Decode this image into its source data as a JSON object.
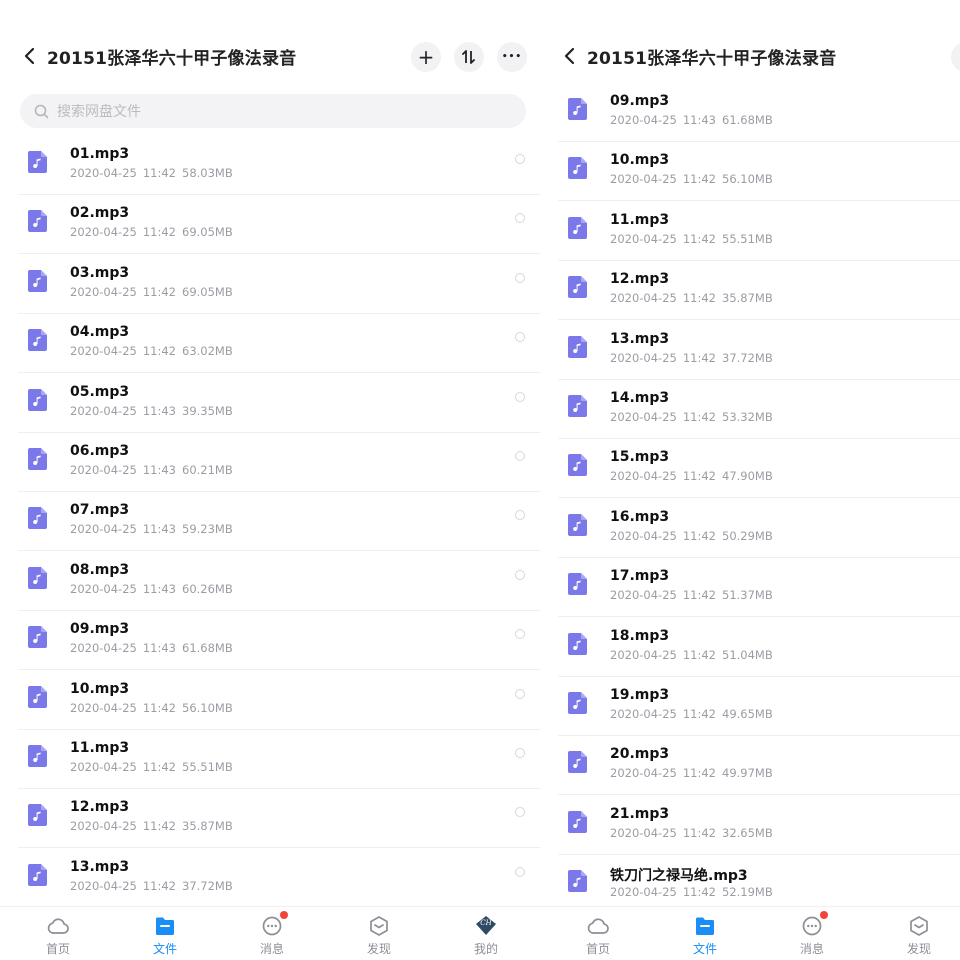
{
  "header": {
    "title": "20151张泽华六十甲子像法录音"
  },
  "toolbar": {
    "add_label": "+",
    "sort_label": "⇅",
    "more_label": "•••"
  },
  "search": {
    "placeholder": "搜索网盘文件"
  },
  "left_files": [
    {
      "name": "01.mp3",
      "date": "2020-04-25",
      "time": "11:42",
      "size": "58.03MB"
    },
    {
      "name": "02.mp3",
      "date": "2020-04-25",
      "time": "11:42",
      "size": "69.05MB"
    },
    {
      "name": "03.mp3",
      "date": "2020-04-25",
      "time": "11:42",
      "size": "69.05MB"
    },
    {
      "name": "04.mp3",
      "date": "2020-04-25",
      "time": "11:42",
      "size": "63.02MB"
    },
    {
      "name": "05.mp3",
      "date": "2020-04-25",
      "time": "11:43",
      "size": "39.35MB"
    },
    {
      "name": "06.mp3",
      "date": "2020-04-25",
      "time": "11:43",
      "size": "60.21MB"
    },
    {
      "name": "07.mp3",
      "date": "2020-04-25",
      "time": "11:43",
      "size": "59.23MB"
    },
    {
      "name": "08.mp3",
      "date": "2020-04-25",
      "time": "11:43",
      "size": "60.26MB"
    },
    {
      "name": "09.mp3",
      "date": "2020-04-25",
      "time": "11:43",
      "size": "61.68MB"
    },
    {
      "name": "10.mp3",
      "date": "2020-04-25",
      "time": "11:42",
      "size": "56.10MB"
    },
    {
      "name": "11.mp3",
      "date": "2020-04-25",
      "time": "11:42",
      "size": "55.51MB"
    },
    {
      "name": "12.mp3",
      "date": "2020-04-25",
      "time": "11:42",
      "size": "35.87MB"
    },
    {
      "name": "13.mp3",
      "date": "2020-04-25",
      "time": "11:42",
      "size": "37.72MB"
    }
  ],
  "right_files": [
    {
      "name": "09.mp3",
      "date": "2020-04-25",
      "time": "11:43",
      "size": "61.68MB"
    },
    {
      "name": "10.mp3",
      "date": "2020-04-25",
      "time": "11:42",
      "size": "56.10MB"
    },
    {
      "name": "11.mp3",
      "date": "2020-04-25",
      "time": "11:42",
      "size": "55.51MB"
    },
    {
      "name": "12.mp3",
      "date": "2020-04-25",
      "time": "11:42",
      "size": "35.87MB"
    },
    {
      "name": "13.mp3",
      "date": "2020-04-25",
      "time": "11:42",
      "size": "37.72MB"
    },
    {
      "name": "14.mp3",
      "date": "2020-04-25",
      "time": "11:42",
      "size": "53.32MB"
    },
    {
      "name": "15.mp3",
      "date": "2020-04-25",
      "time": "11:42",
      "size": "47.90MB"
    },
    {
      "name": "16.mp3",
      "date": "2020-04-25",
      "time": "11:42",
      "size": "50.29MB"
    },
    {
      "name": "17.mp3",
      "date": "2020-04-25",
      "time": "11:42",
      "size": "51.37MB"
    },
    {
      "name": "18.mp3",
      "date": "2020-04-25",
      "time": "11:42",
      "size": "51.04MB"
    },
    {
      "name": "19.mp3",
      "date": "2020-04-25",
      "time": "11:42",
      "size": "49.65MB"
    },
    {
      "name": "20.mp3",
      "date": "2020-04-25",
      "time": "11:42",
      "size": "49.97MB"
    },
    {
      "name": "21.mp3",
      "date": "2020-04-25",
      "time": "11:42",
      "size": "32.65MB"
    },
    {
      "name": "铁刀门之禄马绝.mp3",
      "date": "2020-04-25",
      "time": "11:42",
      "size": "52.19MB"
    }
  ],
  "tabs": [
    {
      "label": "首页",
      "icon": "cloud-icon"
    },
    {
      "label": "文件",
      "icon": "folder-icon",
      "active": true
    },
    {
      "label": "消息",
      "icon": "chat-icon"
    },
    {
      "label": "发现",
      "icon": "cube-icon"
    },
    {
      "label": "我的",
      "icon": "avatar-icon",
      "avatar_text": "CH"
    }
  ],
  "colors": {
    "accent": "#1a8df7",
    "file_icon": "#7b78e9",
    "badge": "#f44336",
    "meta_text": "#9a9da4"
  }
}
